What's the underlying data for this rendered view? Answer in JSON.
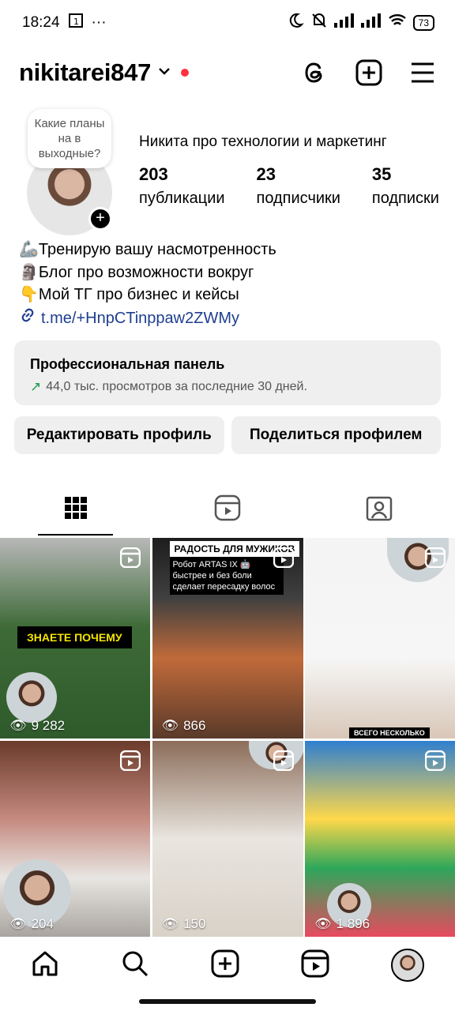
{
  "status_bar": {
    "time": "18:24",
    "battery": "73",
    "extra": "···"
  },
  "header": {
    "username": "nikitarei847",
    "icons": [
      "threads-icon",
      "create-plus-icon",
      "menu-icon"
    ]
  },
  "profile": {
    "note": "Какие планы на в выходные?",
    "display_name": "Никита про технологии и маркетинг",
    "stats": [
      {
        "value": "203",
        "label": "публикации"
      },
      {
        "value": "23",
        "label": "подписчики"
      },
      {
        "value": "35",
        "label": "подписки"
      }
    ],
    "bio": [
      "🦾Тренирую вашу насмотренность",
      "🗿Блог про возможности вокруг",
      "👇Мой ТГ про бизнес и кейсы"
    ],
    "link": "t.me/+HnpCTinppaw2ZWMy"
  },
  "pro_panel": {
    "title": "Профессиональная панель",
    "subtitle": "44,0 тыс. просмотров за последние 30 дней."
  },
  "buttons": {
    "edit": "Редактировать профиль",
    "share": "Поделиться профилем"
  },
  "tabs": [
    "grid-icon",
    "reels-icon",
    "tagged-icon"
  ],
  "posts": [
    {
      "views": "9 282",
      "caption": "ЗНАЕТЕ ПОЧЕМУ"
    },
    {
      "views": "866",
      "caption": "РАДОСТЬ ДЛЯ МУЖИКОВ",
      "sub": "Робот ARTAS IX 🤖 быстрее и без боли сделает пересадку волос"
    },
    {
      "views": "",
      "caption": "ВСЕГО НЕСКОЛЬКО"
    },
    {
      "views": "204"
    },
    {
      "views": "150"
    },
    {
      "views": "1 896"
    }
  ],
  "bottom_nav": [
    "home-icon",
    "search-icon",
    "create-icon",
    "reels-icon",
    "profile-avatar"
  ]
}
